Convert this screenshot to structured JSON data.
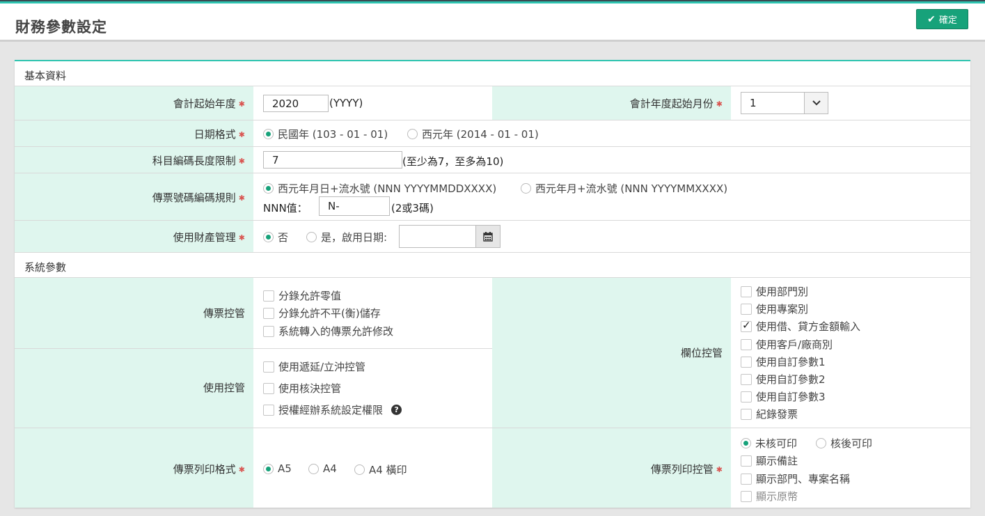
{
  "page": {
    "title": "財務參數設定",
    "confirm_label": "確定"
  },
  "basic": {
    "section_title": "基本資料",
    "fiscal_start_year": {
      "label": "會計起始年度",
      "value": "2020",
      "hint": "(YYYY)"
    },
    "fiscal_start_month": {
      "label": "會計年度起始月份",
      "value": "1"
    },
    "date_format": {
      "label": "日期格式",
      "options": [
        "民國年 (103 - 01 - 01)",
        "西元年 (2014 - 01 - 01)"
      ],
      "selected": 0
    },
    "account_code_length": {
      "label": "科目編碼長度限制",
      "value": "7",
      "hint": "(至少為7，至多為10)"
    },
    "voucher_number_rule": {
      "label": "傳票號碼編碼規則",
      "options": [
        "西元年月日+流水號 (NNN YYYYMMDDXXXX)",
        "西元年月+流水號 (NNN YYYYMMXXXX)"
      ],
      "selected": 0,
      "nnn_label": "NNN值：",
      "nnn_value": "N-",
      "nnn_hint": "(2或3碼)"
    },
    "asset_management": {
      "label": "使用財產管理",
      "option_no": "否",
      "option_yes": "是，啟用日期:",
      "selected": 0,
      "date_value": ""
    }
  },
  "system": {
    "section_title": "系統參數",
    "voucher_control": {
      "label": "傳票控管",
      "items": [
        {
          "label": "分錄允許零值",
          "checked": false
        },
        {
          "label": "分錄允許不平(衡)儲存",
          "checked": false
        },
        {
          "label": "系統轉入的傳票允許修改",
          "checked": false
        }
      ]
    },
    "use_control": {
      "label": "使用控管",
      "items": [
        {
          "label": "使用遞延/立沖控管",
          "checked": false
        },
        {
          "label": "使用核決控管",
          "checked": false
        },
        {
          "label": "授權經辦系統設定權限",
          "checked": false
        }
      ]
    },
    "field_control": {
      "label": "欄位控管",
      "items": [
        {
          "label": "使用部門別",
          "checked": false
        },
        {
          "label": "使用專案別",
          "checked": false
        },
        {
          "label": "使用借、貸方金額輸入",
          "checked": true
        },
        {
          "label": "使用客戶/廠商別",
          "checked": false
        },
        {
          "label": "使用自訂參數1",
          "checked": false
        },
        {
          "label": "使用自訂參數2",
          "checked": false
        },
        {
          "label": "使用自訂參數3",
          "checked": false
        },
        {
          "label": "紀錄發票",
          "checked": false
        }
      ]
    },
    "print_format": {
      "label": "傳票列印格式",
      "options": [
        "A5",
        "A4",
        "A4 橫印"
      ],
      "selected": 0
    },
    "print_control": {
      "label": "傳票列印控管",
      "radio_options": [
        "未核可印",
        "核後可印"
      ],
      "selected": 0,
      "items": [
        {
          "label": "顯示備註",
          "checked": false,
          "disabled": false
        },
        {
          "label": "顯示部門、專案名稱",
          "checked": false,
          "disabled": false
        },
        {
          "label": "顯示原幣",
          "checked": false,
          "disabled": true
        }
      ]
    }
  }
}
